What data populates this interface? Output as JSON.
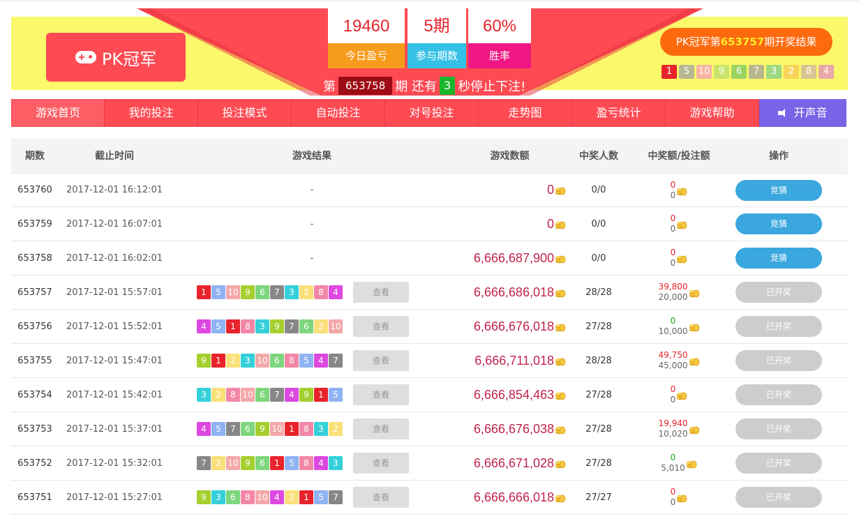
{
  "header": {
    "game_title": "PK冠军",
    "stats": [
      {
        "value": "19460",
        "label": "今日盈亏"
      },
      {
        "value": "5期",
        "label": "参与期数"
      },
      {
        "value": "60%",
        "label": "胜率"
      }
    ],
    "countdown": {
      "prefix": "第",
      "issue": "653758",
      "mid": "期 还有",
      "seconds": "3",
      "suffix": "秒停止下注!"
    },
    "latest_result": {
      "prefix": "PK冠军第",
      "issue": "653757",
      "suffix": "期开奖结果",
      "balls": [
        "1",
        "5",
        "10",
        "9",
        "6",
        "7",
        "3",
        "2",
        "8",
        "4"
      ]
    }
  },
  "nav": {
    "items": [
      "游戏首页",
      "我的投注",
      "投注模式",
      "自动投注",
      "对号投注",
      "走势图",
      "盈亏统计",
      "游戏帮助"
    ],
    "sound": "开声音"
  },
  "table": {
    "headers": [
      "期数",
      "截止时间",
      "游戏结果",
      "游戏数额",
      "中奖人数",
      "中奖额/投注额",
      "操作"
    ],
    "view_label": "查看",
    "rows": [
      {
        "issue": "653760",
        "time": "2017-12-01 16:12:01",
        "result": null,
        "pool": "0",
        "winners": "0/0",
        "prize": "0",
        "bet": "0",
        "op": "竞猜"
      },
      {
        "issue": "653759",
        "time": "2017-12-01 16:07:01",
        "result": null,
        "pool": "0",
        "winners": "0/0",
        "prize": "0",
        "bet": "0",
        "op": "竞猜"
      },
      {
        "issue": "653758",
        "time": "2017-12-01 16:02:01",
        "result": null,
        "pool": "6,666,687,900",
        "winners": "0/0",
        "prize": "0",
        "bet": "0",
        "op": "竞猜"
      },
      {
        "issue": "653757",
        "time": "2017-12-01 15:57:01",
        "result": [
          "1",
          "5",
          "10",
          "9",
          "6",
          "7",
          "3",
          "2",
          "8",
          "4"
        ],
        "pool": "6,666,686,018",
        "winners": "28/28",
        "prize": "39,800",
        "bet": "20,000",
        "op": "已开奖"
      },
      {
        "issue": "653756",
        "time": "2017-12-01 15:52:01",
        "result": [
          "4",
          "5",
          "1",
          "8",
          "3",
          "9",
          "7",
          "6",
          "2",
          "10"
        ],
        "pool": "6,666,676,018",
        "winners": "27/28",
        "prize": "0",
        "bet": "10,000",
        "op": "已开奖"
      },
      {
        "issue": "653755",
        "time": "2017-12-01 15:47:01",
        "result": [
          "9",
          "1",
          "2",
          "3",
          "10",
          "6",
          "8",
          "5",
          "4",
          "7"
        ],
        "pool": "6,666,711,018",
        "winners": "28/28",
        "prize": "49,750",
        "bet": "45,000",
        "op": "已开奖"
      },
      {
        "issue": "653754",
        "time": "2017-12-01 15:42:01",
        "result": [
          "3",
          "2",
          "8",
          "10",
          "6",
          "7",
          "4",
          "9",
          "1",
          "5"
        ],
        "pool": "6,666,854,463",
        "winners": "27/28",
        "prize": "0",
        "bet": "0",
        "op": "已开奖"
      },
      {
        "issue": "653753",
        "time": "2017-12-01 15:37:01",
        "result": [
          "4",
          "5",
          "7",
          "6",
          "9",
          "10",
          "1",
          "8",
          "3",
          "2"
        ],
        "pool": "6,666,676,038",
        "winners": "27/28",
        "prize": "19,940",
        "bet": "10,020",
        "op": "已开奖"
      },
      {
        "issue": "653752",
        "time": "2017-12-01 15:32:01",
        "result": [
          "7",
          "2",
          "10",
          "9",
          "6",
          "1",
          "5",
          "8",
          "4",
          "3"
        ],
        "pool": "6,666,671,028",
        "winners": "27/28",
        "prize": "0",
        "bet": "5,010",
        "op": "已开奖"
      },
      {
        "issue": "653751",
        "time": "2017-12-01 15:27:01",
        "result": [
          "9",
          "3",
          "6",
          "8",
          "10",
          "4",
          "2",
          "1",
          "5",
          "7"
        ],
        "pool": "6,666,666,018",
        "winners": "27/27",
        "prize": "0",
        "bet": "0",
        "op": "已开奖"
      }
    ]
  },
  "ball_colors": {
    "1": "#e8232b",
    "2": "#fbe07a",
    "3": "#35d0d9",
    "4": "#dc48e0",
    "5": "#8fb3f3",
    "6": "#7dd67d",
    "7": "#878787",
    "8": "#f287a8",
    "9": "#a5cf2e",
    "10": "#f4a8a8"
  },
  "ball_colors_header": {
    "1": "#e8232b",
    "2": "#f8d45a",
    "3": "#9fd880",
    "4": "#e9a8a8",
    "5": "#b8b894",
    "6": "#9bd360",
    "7": "#b7b78b",
    "8": "#d9c58f",
    "9": "#c8e46a",
    "10": "#f6b3a4"
  },
  "colors": {
    "primary": "#fd4a53",
    "banner": "#fbf86b",
    "sound": "#7b63e7",
    "bet_btn": "#3aa7de",
    "done_btn": "#cdcdcd"
  }
}
